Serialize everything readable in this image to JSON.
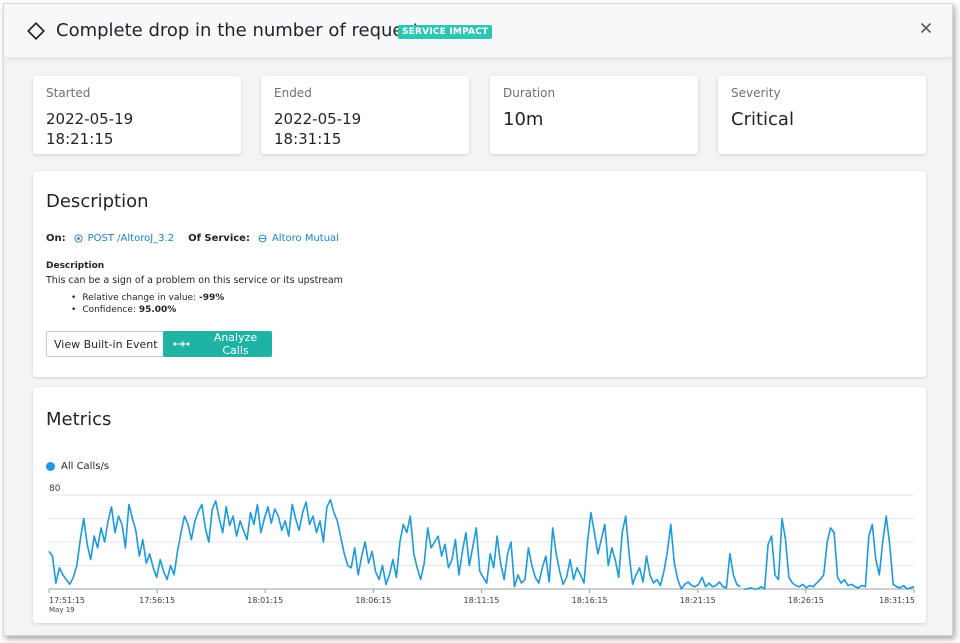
{
  "header": {
    "title": "Complete drop in the number of requests",
    "badge": "SERVICE IMPACT",
    "accent_color": "#2ec4b6",
    "icons": {
      "type": "diamond-icon",
      "close": "close-icon"
    }
  },
  "stats": [
    {
      "label": "Started",
      "value_line1": "2022-05-19",
      "value_line2": "18:21:15"
    },
    {
      "label": "Ended",
      "value_line1": "2022-05-19",
      "value_line2": "18:31:15"
    },
    {
      "label": "Duration",
      "value": "10m"
    },
    {
      "label": "Severity",
      "value": "Critical"
    }
  ],
  "description": {
    "title": "Description",
    "on_label": "On:",
    "on_value": "POST /AltoroJ_3.2",
    "service_label": "Of Service:",
    "service_value": "Altoro Mutual",
    "subheading": "Description",
    "text": "This can be a sign of a problem on this service or its upstream",
    "bullet1_label": "Relative change in value:",
    "bullet1_value": "-99%",
    "bullet2_label": "Confidence:",
    "bullet2_value": "95.00%",
    "view_button": "View Built-in Event",
    "analyze_button": "Analyze Calls",
    "link_color": "#1b7fc4",
    "button_color": "#1fb3a6"
  },
  "metrics": {
    "title": "Metrics"
  },
  "chart_data": {
    "type": "line",
    "series": [
      {
        "name": "All Calls/s",
        "color": "#1b9ae0",
        "x": [
          0,
          1,
          2,
          3,
          4,
          5,
          6,
          7,
          8,
          9,
          10,
          11,
          12,
          13,
          14,
          15,
          16,
          17,
          18,
          19,
          20,
          21,
          22,
          23,
          24,
          25,
          26,
          27,
          28,
          29,
          30,
          31,
          32,
          33,
          34,
          35,
          36,
          37,
          38,
          39,
          40,
          41,
          42,
          43,
          44,
          45,
          46,
          47,
          48,
          49,
          50,
          51,
          52,
          53,
          54,
          55,
          56,
          57,
          58,
          59,
          60,
          61,
          62,
          63,
          64,
          65,
          66,
          67,
          68,
          69,
          70,
          71,
          72,
          73,
          74,
          75,
          76,
          77,
          78,
          79,
          80,
          81,
          82,
          83,
          84,
          85,
          86,
          87,
          88,
          89,
          90,
          91,
          92,
          93,
          94,
          95,
          96,
          97,
          98,
          99,
          100,
          101,
          102,
          103,
          104,
          105,
          106,
          107,
          108,
          109,
          110,
          111,
          112,
          113,
          114,
          115,
          116,
          117,
          118,
          119,
          120,
          121,
          122,
          123,
          124,
          125,
          126,
          127,
          128,
          129,
          130,
          131,
          132,
          133,
          134,
          135,
          136,
          137,
          138,
          139,
          140,
          141,
          142,
          143,
          144,
          145,
          146,
          147,
          148,
          149,
          150,
          151,
          152,
          153,
          154,
          155,
          156,
          157,
          158,
          159,
          160,
          161,
          162,
          163,
          164,
          165,
          166,
          167,
          168,
          169,
          170,
          171,
          172,
          173,
          174,
          175,
          176,
          177,
          178,
          179,
          180,
          181,
          182,
          183,
          184,
          185,
          186,
          187,
          188,
          189,
          190,
          191,
          192,
          193,
          194,
          195,
          196,
          197,
          198,
          199
        ],
        "values": [
          32,
          28,
          5,
          18,
          12,
          8,
          4,
          10,
          20,
          42,
          60,
          38,
          25,
          45,
          35,
          52,
          40,
          58,
          70,
          48,
          62,
          55,
          35,
          72,
          60,
          50,
          28,
          42,
          22,
          30,
          18,
          10,
          25,
          15,
          8,
          20,
          12,
          32,
          48,
          62,
          55,
          42,
          58,
          66,
          72,
          52,
          40,
          68,
          75,
          60,
          48,
          70,
          54,
          62,
          45,
          58,
          50,
          42,
          65,
          55,
          72,
          48,
          60,
          70,
          56,
          68,
          62,
          50,
          58,
          45,
          72,
          60,
          50,
          65,
          74,
          55,
          62,
          48,
          58,
          40,
          70,
          76,
          65,
          58,
          44,
          30,
          20,
          18,
          35,
          12,
          28,
          40,
          22,
          32,
          15,
          8,
          20,
          4,
          12,
          25,
          10,
          40,
          55,
          48,
          62,
          30,
          18,
          8,
          22,
          52,
          35,
          40,
          45,
          28,
          38,
          18,
          25,
          42,
          12,
          32,
          48,
          20,
          36,
          52,
          15,
          10,
          5,
          30,
          18,
          45,
          22,
          8,
          30,
          40,
          2,
          12,
          5,
          8,
          35,
          20,
          10,
          5,
          18,
          28,
          6,
          52,
          30,
          15,
          4,
          10,
          25,
          8,
          18,
          12,
          5,
          40,
          65,
          48,
          30,
          42,
          55,
          20,
          35,
          25,
          10,
          48,
          62,
          30,
          4,
          12,
          18,
          6,
          28,
          12,
          5,
          8,
          3,
          15,
          32,
          55,
          22,
          8,
          0,
          4,
          6,
          3,
          2,
          4,
          10,
          2,
          5,
          2,
          3,
          6,
          2,
          1,
          30,
          12,
          4,
          2
        ]
      },
      {
        "name": "All Calls/s",
        "color": "#1b9ae0",
        "x": [
          200,
          201,
          202,
          203,
          204,
          205,
          206,
          207,
          208,
          209,
          210,
          211,
          212,
          213,
          214,
          215,
          216,
          217,
          218,
          219,
          220,
          221,
          222,
          223,
          224,
          225,
          226,
          227,
          228,
          229,
          230,
          231,
          232,
          233,
          234,
          235,
          236,
          237,
          238,
          239,
          240,
          241,
          242,
          243,
          244,
          245,
          246,
          247,
          248,
          249
        ],
        "values": [
          0,
          0,
          1,
          0,
          0,
          2,
          0,
          38,
          45,
          12,
          8,
          60,
          42,
          10,
          5,
          3,
          2,
          4,
          1,
          3,
          2,
          5,
          8,
          12,
          40,
          52,
          48,
          10,
          5,
          8,
          3,
          4,
          2,
          1,
          3,
          2,
          45,
          55,
          25,
          12,
          40,
          62,
          38,
          4,
          2,
          1,
          3,
          0,
          1,
          2
        ]
      }
    ],
    "x_ticks": [
      "17:51:15",
      "17:56:15",
      "18:01:15",
      "18:06:15",
      "18:11:15",
      "18:16:15",
      "18:21:15",
      "18:26:15",
      "18:31:15"
    ],
    "x_sublabel": "May 19",
    "y_ticks": [
      "80"
    ],
    "ylim": [
      0,
      80
    ],
    "grid": true,
    "legend": "top-left"
  }
}
